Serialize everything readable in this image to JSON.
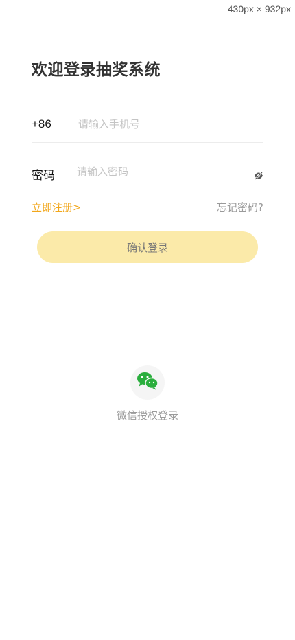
{
  "size_hint": "430px × 932px",
  "title": "欢迎登录抽奖系统",
  "phone": {
    "prefix": "+86",
    "placeholder": "请输入手机号",
    "value": ""
  },
  "password": {
    "label": "密码",
    "placeholder": "请输入密码",
    "value": ""
  },
  "links": {
    "register": "立即注册>",
    "forgot": "忘记密码?"
  },
  "confirm_label": "确认登录",
  "wechat": {
    "label": "微信授权登录",
    "icon": "wechat-icon"
  },
  "icons": {
    "password_toggle": "eye-off-icon"
  },
  "colors": {
    "accent": "#f2a71b",
    "button_bg": "#fbeaa9",
    "wechat_green": "#2aae3d",
    "muted_text": "#9a9a9a",
    "placeholder": "#c4c4c4"
  }
}
